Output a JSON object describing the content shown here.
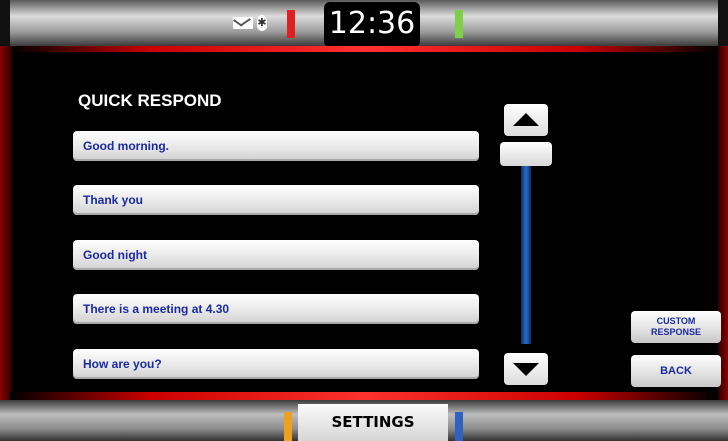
{
  "status": {
    "time": "12:36",
    "icons": [
      "mail-icon",
      "bluetooth-icon"
    ],
    "bluetooth_glyph": "✱"
  },
  "screen": {
    "title": "QUICK RESPOND",
    "options": [
      "Good morning.",
      "Thank you",
      "Good night",
      "There is a meeting at 4.30",
      "How are you?"
    ]
  },
  "side_buttons": {
    "custom_line1": "CUSTOM",
    "custom_line2": "RESPONSE",
    "back": "BACK"
  },
  "bottom": {
    "settings": "SETTINGS"
  },
  "colors": {
    "accent_red": "#e02020",
    "option_text": "#1a2aa0",
    "scroll_track": "#2a6ec8"
  }
}
